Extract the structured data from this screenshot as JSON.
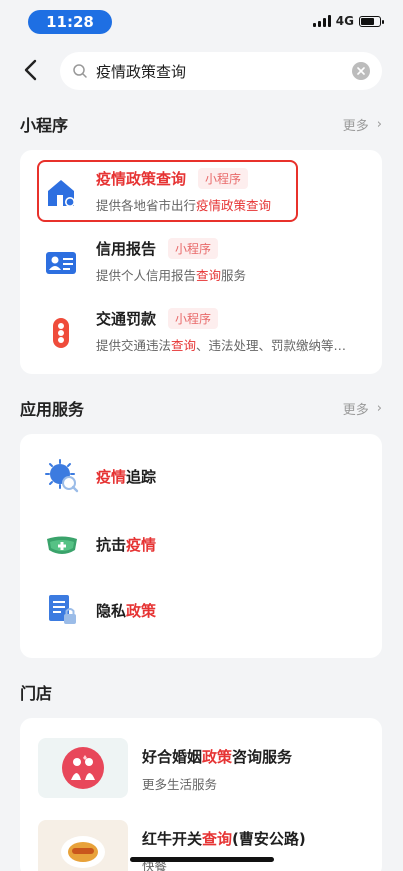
{
  "status": {
    "time": "11:28",
    "network": "4G"
  },
  "search": {
    "query": "疫情政策查询"
  },
  "mini_programs": {
    "title": "小程序",
    "more": "更多",
    "items": [
      {
        "name_hl": "疫情政策查询",
        "name_rest": "",
        "tag": "小程序",
        "desc_pre": "提供各地省市出行",
        "desc_hl": "疫情政策查询",
        "desc_post": "",
        "icon": "home-search-icon"
      },
      {
        "name_hl": "",
        "name_rest": "信用报告",
        "tag": "小程序",
        "desc_pre": "提供个人信用报告",
        "desc_hl": "查询",
        "desc_post": "服务",
        "icon": "id-card-icon"
      },
      {
        "name_hl": "",
        "name_rest": "交通罚款",
        "tag": "小程序",
        "desc_pre": "提供交通违法",
        "desc_hl": "查询",
        "desc_post": "、违法处理、罚款缴纳等…",
        "icon": "traffic-light-icon"
      }
    ]
  },
  "services": {
    "title": "应用服务",
    "more": "更多",
    "items": [
      {
        "hl": "疫情",
        "rest": "追踪",
        "icon": "virus-search-icon"
      },
      {
        "pre": "抗击",
        "hl": "疫情",
        "icon": "mask-icon"
      },
      {
        "pre": "隐私",
        "hl": "政策",
        "icon": "document-lock-icon"
      }
    ]
  },
  "stores": {
    "title": "门店",
    "items": [
      {
        "pre": "好合婚姻",
        "hl": "政策",
        "post": "咨询服务",
        "sub": "更多生活服务",
        "icon": "wedding-couple-icon"
      },
      {
        "pre": "红牛开关",
        "hl": "查询",
        "post": "(曹安公路)",
        "sub": "快餐",
        "icon": "food-plate-icon"
      }
    ]
  },
  "colors": {
    "accent": "#1e6fe3",
    "highlight": "#e63434",
    "frame": "#e8312b"
  }
}
